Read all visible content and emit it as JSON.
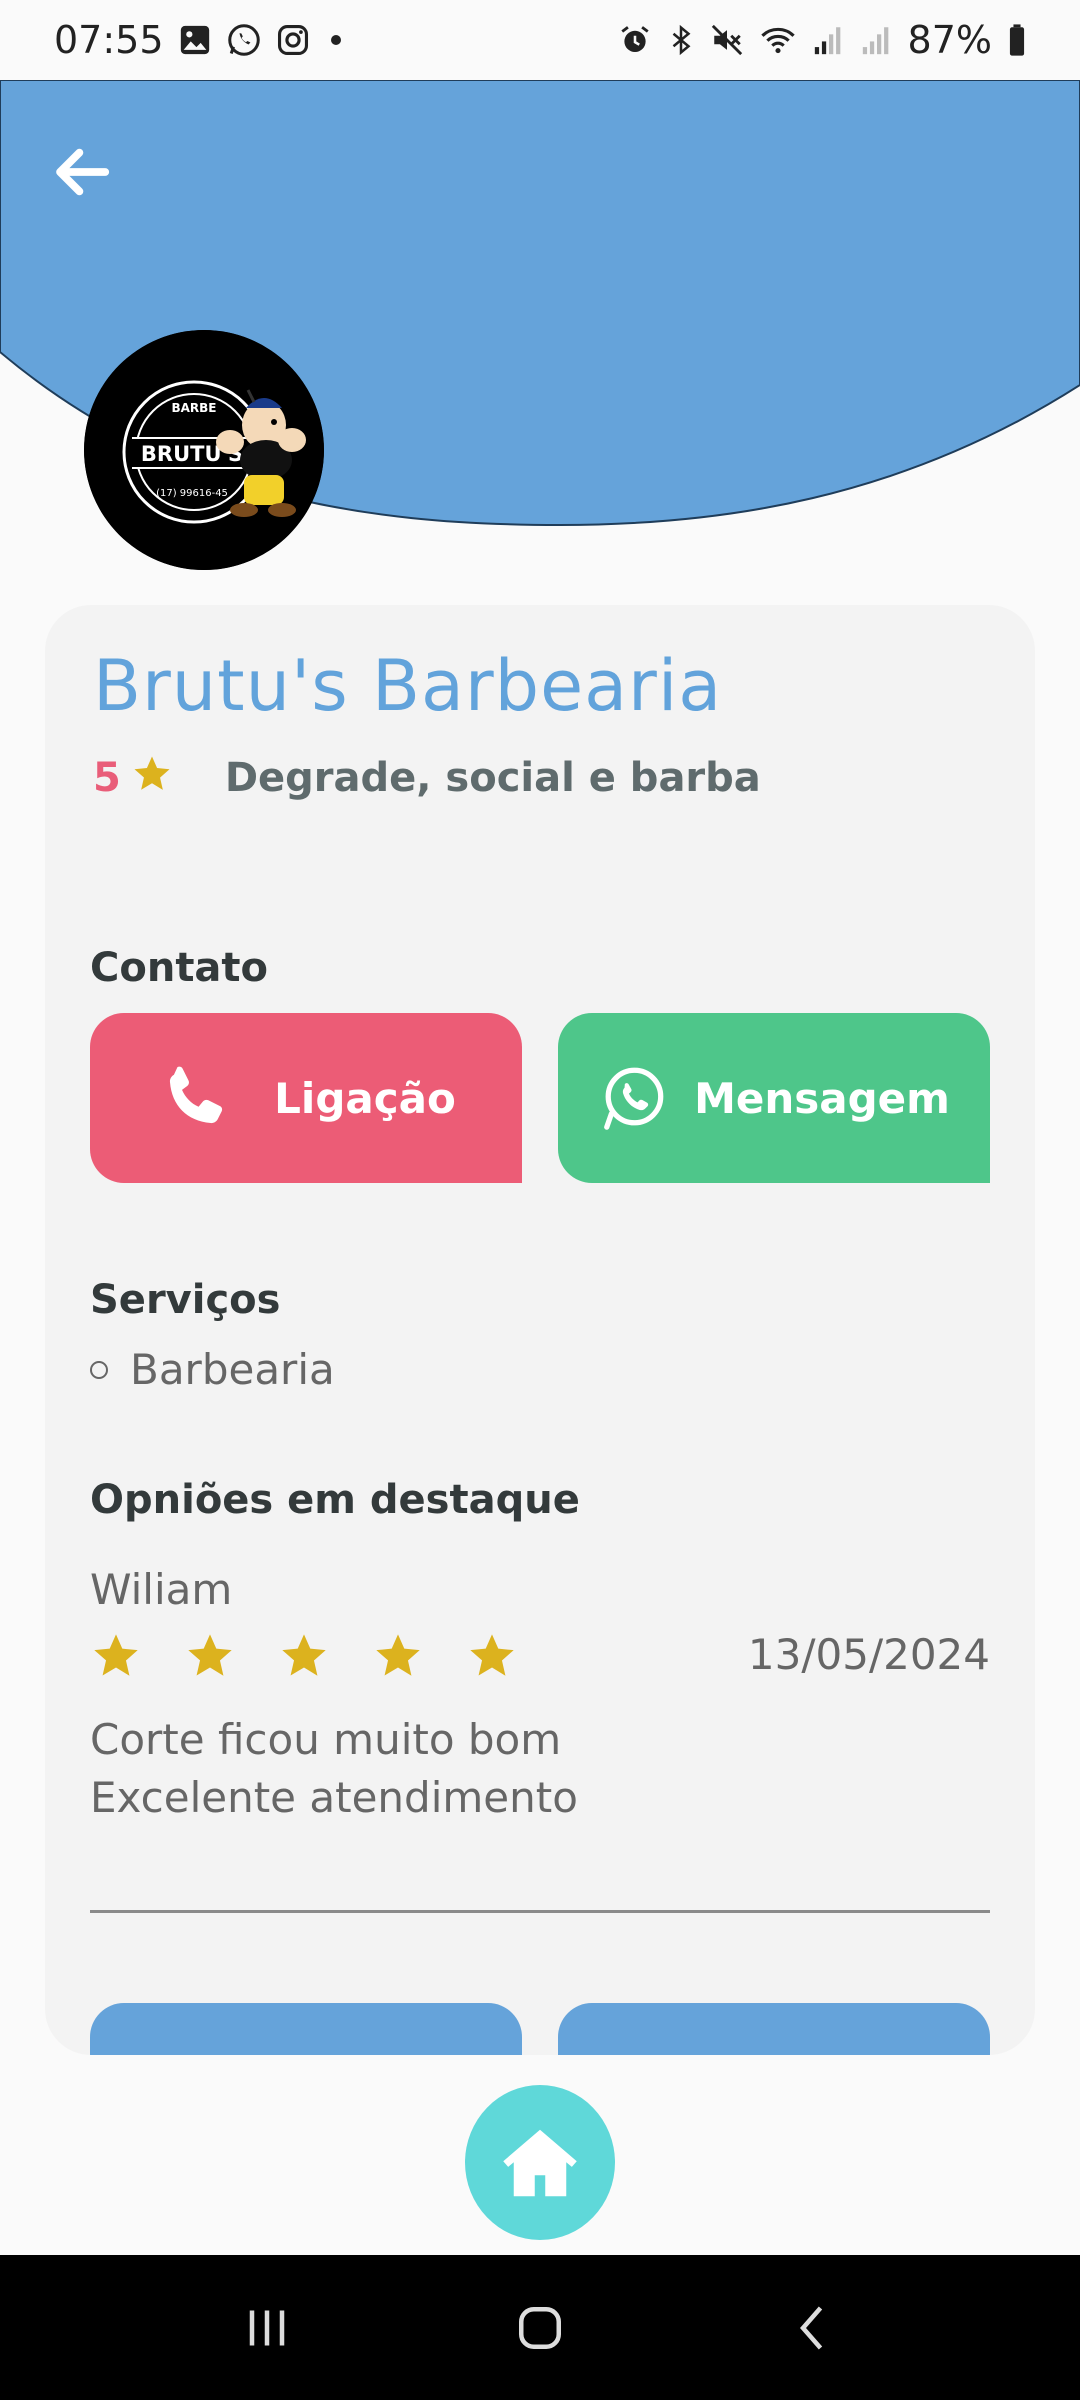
{
  "status_bar": {
    "time": "07:55",
    "battery": "87%",
    "left_icons": [
      "gallery-icon",
      "whatsapp-icon",
      "instagram-icon",
      "dot-icon"
    ],
    "right_icons": [
      "alarm-icon",
      "bluetooth-icon",
      "mute-icon",
      "wifi-icon",
      "signal-icon",
      "signal-icon",
      "battery-icon"
    ]
  },
  "header": {
    "back_icon": "arrow-left-icon",
    "color": "#65a3da"
  },
  "profile": {
    "name": "Brutu's Barbearia",
    "rating": "5",
    "tagline": "Degrade, social e barba",
    "logo": {
      "top": "BARBE",
      "main": "BRUTU'S",
      "bottom": "(17) 99616-45"
    }
  },
  "contact": {
    "label": "Contato",
    "call_label": "Ligação",
    "message_label": "Mensagem",
    "call_color": "#ec5c76",
    "message_color": "#4ec68a"
  },
  "services": {
    "label": "Serviços",
    "items": [
      "Barbearia"
    ]
  },
  "reviews": {
    "label": "Opniões em destaque",
    "items": [
      {
        "author": "Wiliam",
        "stars": 5,
        "date": "13/05/2024",
        "lines": [
          "Corte ficou muito bom",
          "Excelente atendimento"
        ]
      }
    ]
  },
  "colors": {
    "accent": "#62a3db",
    "star": "#dcb21e",
    "fab": "#5fd8d9"
  },
  "fab": {
    "icon": "home-icon"
  },
  "nav": {
    "icons": [
      "recent-apps-icon",
      "home-nav-icon",
      "back-nav-icon"
    ]
  }
}
